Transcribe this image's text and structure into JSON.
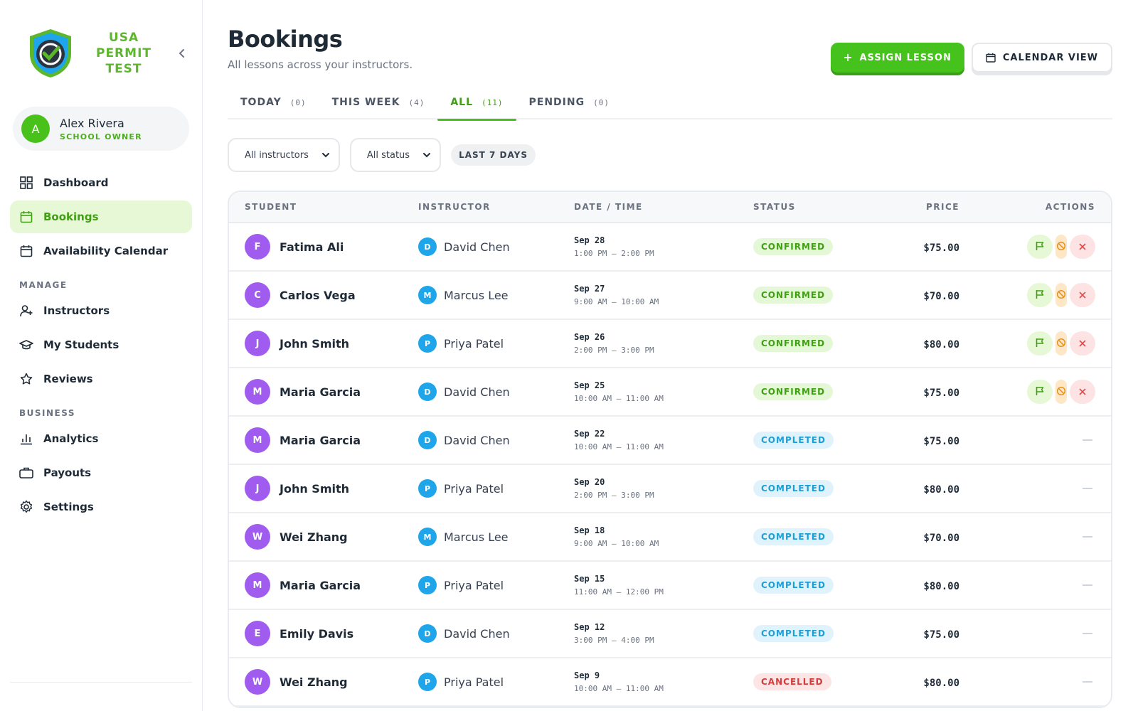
{
  "brand": {
    "name_line1": "USA PERMIT",
    "name_line2": "TEST"
  },
  "user": {
    "initial": "A",
    "name": "Alex Rivera",
    "role": "SCHOOL OWNER"
  },
  "nav": {
    "dashboard": "Dashboard",
    "bookings": "Bookings",
    "availability": "Availability Calendar",
    "manage_section": "MANAGE",
    "instructors": "Instructors",
    "students": "My Students",
    "reviews": "Reviews",
    "business_section": "BUSINESS",
    "analytics": "Analytics",
    "payouts": "Payouts",
    "settings": "Settings"
  },
  "header": {
    "title": "Bookings",
    "subtitle": "All lessons across your instructors.",
    "assign_label": "ASSIGN LESSON",
    "calendar_label": "CALENDAR VIEW"
  },
  "tabs": [
    {
      "label": "TODAY",
      "count": "(0)"
    },
    {
      "label": "THIS WEEK",
      "count": "(4)"
    },
    {
      "label": "ALL",
      "count": "(11)"
    },
    {
      "label": "PENDING",
      "count": "(0)"
    }
  ],
  "active_tab": "ALL",
  "filters": {
    "instructors_value": "All instructors",
    "status_value": "All status",
    "range_chip": "LAST 7 DAYS"
  },
  "table": {
    "headers": {
      "student": "STUDENT",
      "instructor": "INSTRUCTOR",
      "datetime": "DATE / TIME",
      "status": "STATUS",
      "price": "PRICE",
      "actions": "ACTIONS"
    },
    "rows": [
      {
        "s_initial": "F",
        "student": "Fatima Ali",
        "i_initial": "D",
        "instructor": "David Chen",
        "date": "Sep 28",
        "time": "1:00 PM – 2:00 PM",
        "status": "CONFIRMED",
        "status_kind": "confirmed",
        "price": "$75.00",
        "actions": true
      },
      {
        "s_initial": "C",
        "student": "Carlos Vega",
        "i_initial": "M",
        "instructor": "Marcus Lee",
        "date": "Sep 27",
        "time": "9:00 AM – 10:00 AM",
        "status": "CONFIRMED",
        "status_kind": "confirmed",
        "price": "$70.00",
        "actions": true
      },
      {
        "s_initial": "J",
        "student": "John Smith",
        "i_initial": "P",
        "instructor": "Priya Patel",
        "date": "Sep 26",
        "time": "2:00 PM – 3:00 PM",
        "status": "CONFIRMED",
        "status_kind": "confirmed",
        "price": "$80.00",
        "actions": true
      },
      {
        "s_initial": "M",
        "student": "Maria Garcia",
        "i_initial": "D",
        "instructor": "David Chen",
        "date": "Sep 25",
        "time": "10:00 AM – 11:00 AM",
        "status": "CONFIRMED",
        "status_kind": "confirmed",
        "price": "$75.00",
        "actions": true
      },
      {
        "s_initial": "M",
        "student": "Maria Garcia",
        "i_initial": "D",
        "instructor": "David Chen",
        "date": "Sep 22",
        "time": "10:00 AM – 11:00 AM",
        "status": "COMPLETED",
        "status_kind": "completed",
        "price": "$75.00",
        "actions": false
      },
      {
        "s_initial": "J",
        "student": "John Smith",
        "i_initial": "P",
        "instructor": "Priya Patel",
        "date": "Sep 20",
        "time": "2:00 PM – 3:00 PM",
        "status": "COMPLETED",
        "status_kind": "completed",
        "price": "$80.00",
        "actions": false
      },
      {
        "s_initial": "W",
        "student": "Wei Zhang",
        "i_initial": "M",
        "instructor": "Marcus Lee",
        "date": "Sep 18",
        "time": "9:00 AM – 10:00 AM",
        "status": "COMPLETED",
        "status_kind": "completed",
        "price": "$70.00",
        "actions": false
      },
      {
        "s_initial": "M",
        "student": "Maria Garcia",
        "i_initial": "P",
        "instructor": "Priya Patel",
        "date": "Sep 15",
        "time": "11:00 AM – 12:00 PM",
        "status": "COMPLETED",
        "status_kind": "completed",
        "price": "$80.00",
        "actions": false
      },
      {
        "s_initial": "E",
        "student": "Emily Davis",
        "i_initial": "D",
        "instructor": "David Chen",
        "date": "Sep 12",
        "time": "3:00 PM – 4:00 PM",
        "status": "COMPLETED",
        "status_kind": "completed",
        "price": "$75.00",
        "actions": false
      },
      {
        "s_initial": "W",
        "student": "Wei Zhang",
        "i_initial": "P",
        "instructor": "Priya Patel",
        "date": "Sep 9",
        "time": "10:00 AM – 11:00 AM",
        "status": "CANCELLED",
        "status_kind": "cancelled",
        "price": "$80.00",
        "actions": false
      }
    ]
  },
  "colors": {
    "accent": "#45c21b",
    "student_avatar": "#a05cef",
    "instructor_avatar": "#1fa6ea"
  },
  "icons": [
    "logo-icon",
    "chevron-left-icon",
    "grid-icon",
    "calendar-icon",
    "user-plus-icon",
    "graduation-cap-icon",
    "star-icon",
    "bar-chart-icon",
    "briefcase-icon",
    "gear-icon",
    "plus-icon",
    "chevron-down-icon",
    "flag-icon",
    "no-show-icon",
    "close-icon"
  ]
}
